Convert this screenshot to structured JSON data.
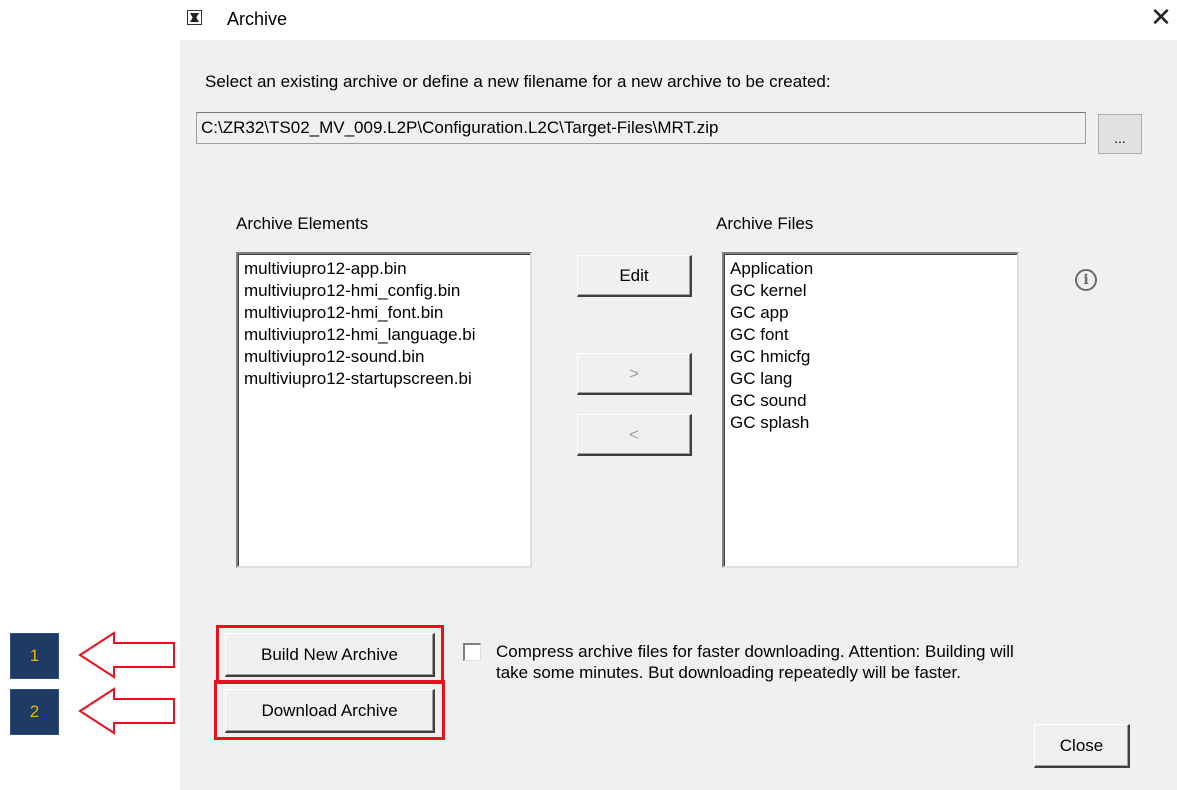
{
  "window": {
    "title": "Archive",
    "close_glyph": "✕"
  },
  "prompt": "Select an existing archive or define a new filename for a new archive to be created:",
  "archive_path": "C:\\ZR32\\TS02_MV_009.L2P\\Configuration.L2C\\Target-Files\\MRT.zip",
  "browse_label": "...",
  "elements": {
    "header": "Archive Elements",
    "items": [
      "multiviupro12-app.bin",
      "multiviupro12-hmi_config.bin",
      "multiviupro12-hmi_font.bin",
      "multiviupro12-hmi_language.bi",
      "multiviupro12-sound.bin",
      "multiviupro12-startupscreen.bi"
    ]
  },
  "files": {
    "header": "Archive Files",
    "items": [
      "Application",
      "GC kernel",
      "GC app",
      "GC font",
      "GC hmicfg",
      "GC lang",
      "GC sound",
      "GC splash"
    ]
  },
  "buttons": {
    "edit": "Edit",
    "move_right": ">",
    "move_left": "<",
    "build": "Build New Archive",
    "download": "Download Archive",
    "close": "Close"
  },
  "info_glyph": "i",
  "compress": {
    "checked": false,
    "line1": "Compress archive files for faster downloading. Attention: Building will",
    "line2": "take some minutes. But downloading repeatedly will be faster."
  },
  "annotations": {
    "step1": "1",
    "step2": "2",
    "arrow_color": "#e8101a",
    "badge_color": "#1f3b63",
    "badge_text_color": "#f4b400"
  }
}
